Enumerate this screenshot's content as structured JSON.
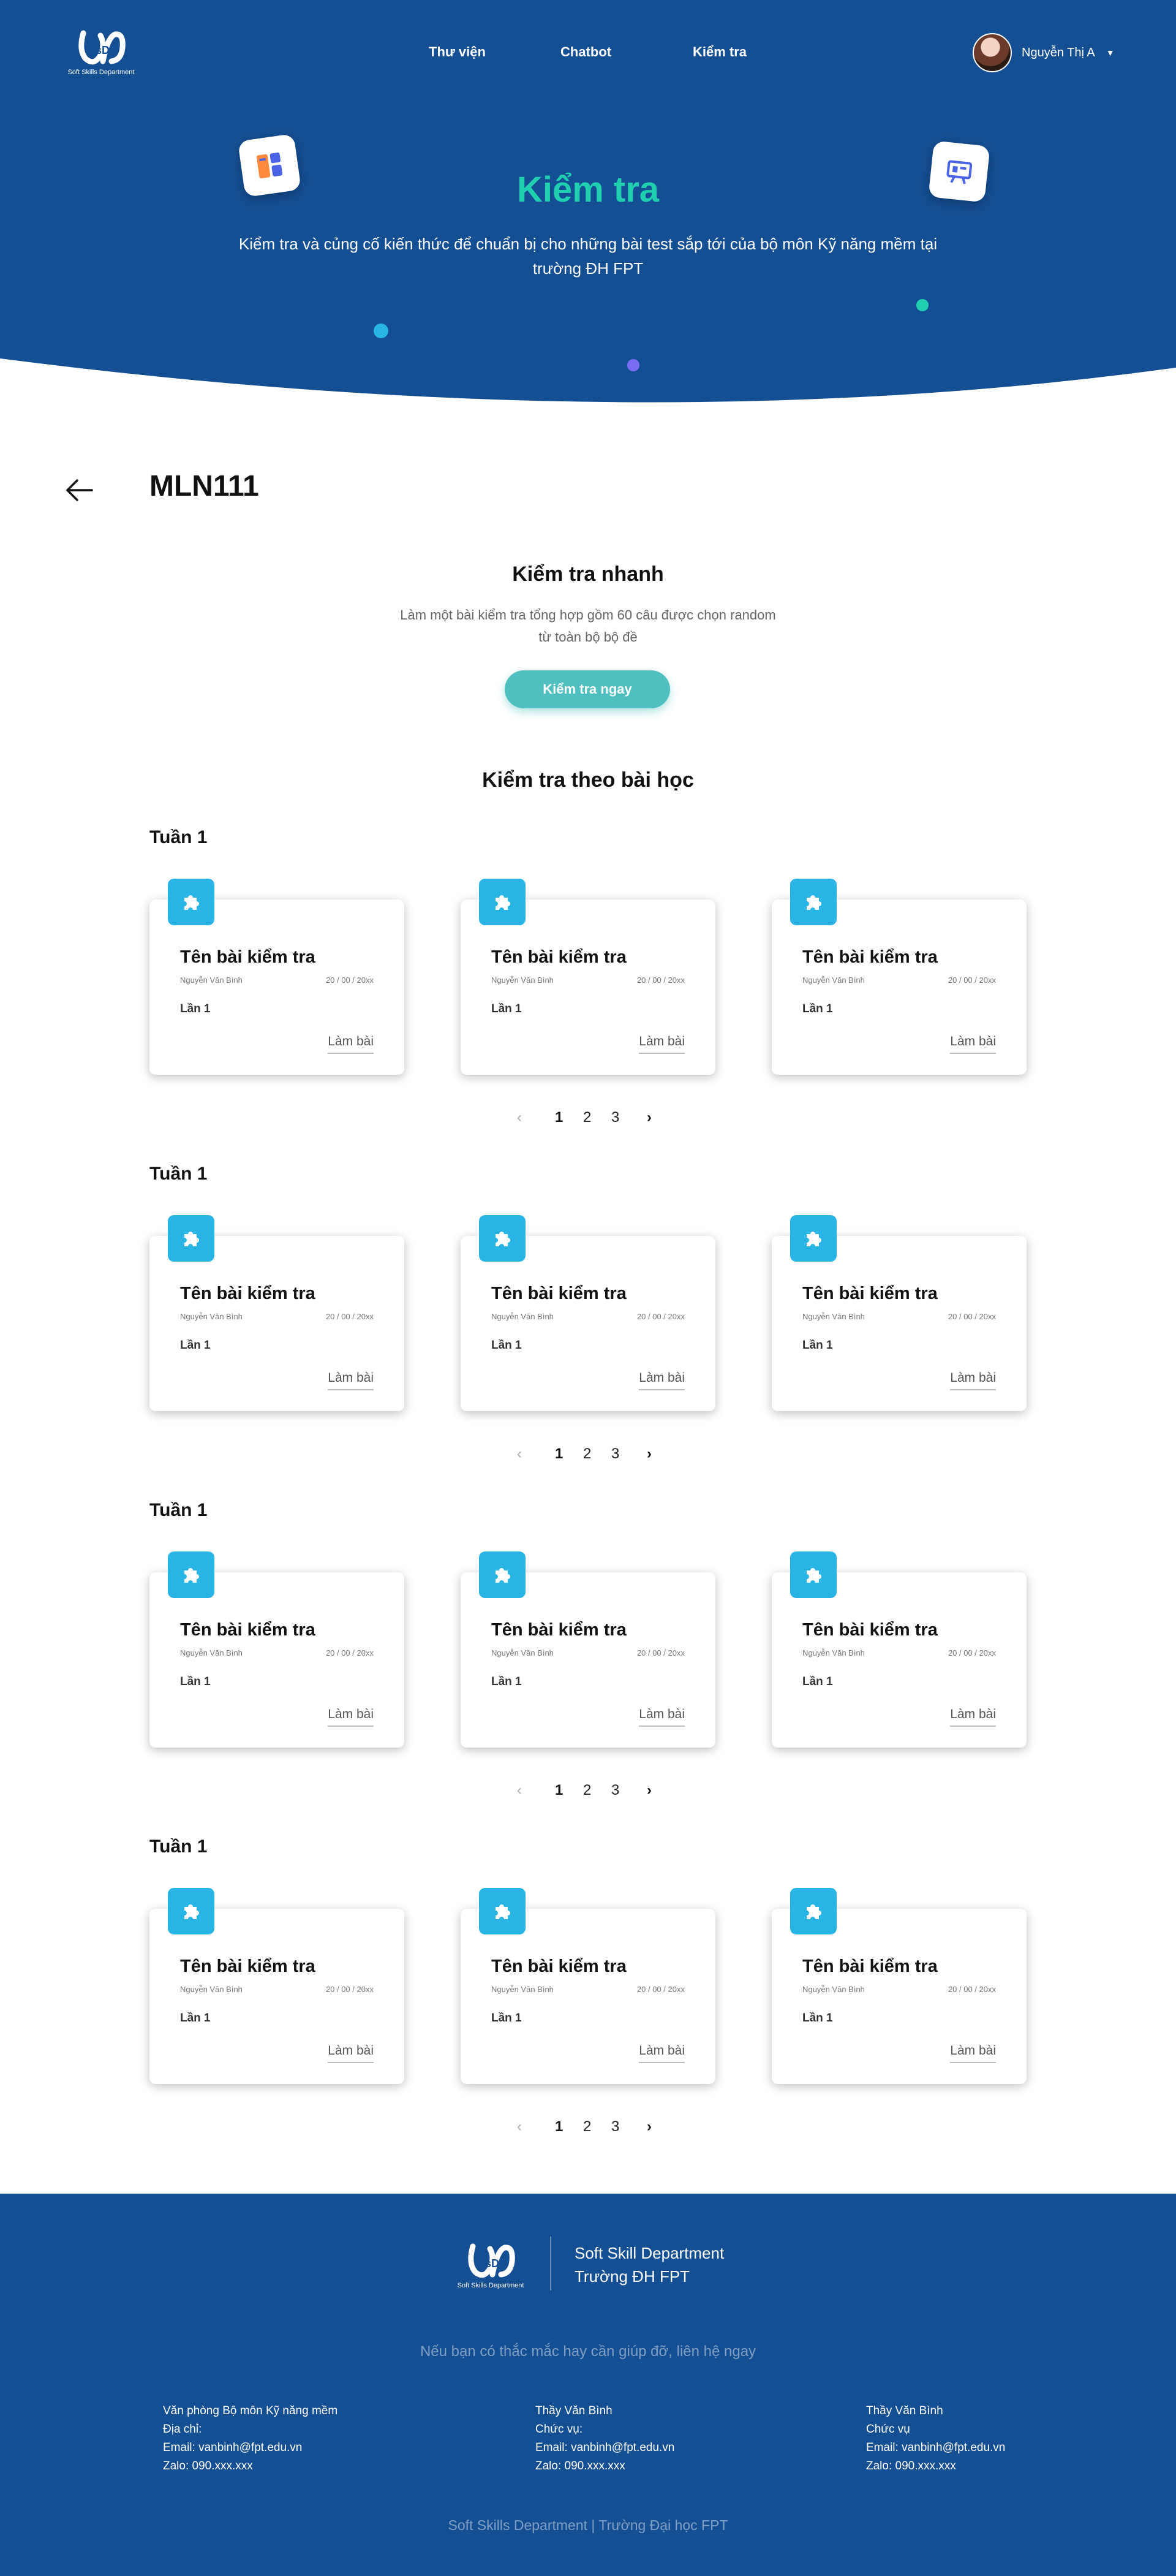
{
  "colors": {
    "primary_blue": "#154f93",
    "accent_teal": "#1fcfb0",
    "button_teal": "#4fbfbf",
    "badge_blue": "#29b4e6",
    "dot_blue": "#29b4e6",
    "dot_purple": "#7b6cf6",
    "dot_teal": "#1fcfb0"
  },
  "brand": {
    "logo_caption": "Soft Skills Department",
    "logo_icon": "sd-logo-icon"
  },
  "nav": {
    "links": [
      "Thư viện",
      "Chatbot",
      "Kiểm tra"
    ],
    "user_name": "Nguyễn Thị A",
    "user_menu_icon": "chevron-down-icon"
  },
  "hero": {
    "title": "Kiểm tra",
    "subtitle": "Kiểm tra và củng cố kiến thức để chuẩn bị cho những bài test sắp tới của bộ môn Kỹ năng mềm tại trường ĐH FPT",
    "icons": [
      "layout-icon",
      "presentation-board-icon"
    ]
  },
  "course": {
    "back_icon": "arrow-left-icon",
    "title": "MLN111"
  },
  "quick_test": {
    "title": "Kiểm tra nhanh",
    "description": "Làm một bài kiểm tra tổng hợp gồm 60 câu được chọn random từ toàn bộ bộ đề",
    "button_label": "Kiểm tra ngay"
  },
  "lessons": {
    "title": "Kiểm tra theo bài học",
    "card_icon": "puzzle-icon",
    "weeks": [
      {
        "label": "Tuần 1",
        "cards": [
          {
            "title": "Tên bài kiểm tra",
            "author": "Nguyễn Văn Bình",
            "date": "20 / 00 / 20xx",
            "attempt": "Lần 1",
            "action": "Làm bài"
          },
          {
            "title": "Tên bài kiểm tra",
            "author": "Nguyễn Văn Bình",
            "date": "20 / 00 / 20xx",
            "attempt": "Lần 1",
            "action": "Làm bài"
          },
          {
            "title": "Tên bài kiểm tra",
            "author": "Nguyễn Văn Bình",
            "date": "20 / 00 / 20xx",
            "attempt": "Lần 1",
            "action": "Làm bài"
          }
        ],
        "pagination": {
          "prev": "‹",
          "pages": [
            "1",
            "2",
            "3"
          ],
          "next": "›",
          "current": "1"
        }
      },
      {
        "label": "Tuần 1",
        "cards": [
          {
            "title": "Tên bài kiểm tra",
            "author": "Nguyễn Văn Bình",
            "date": "20 / 00 / 20xx",
            "attempt": "Lần 1",
            "action": "Làm bài"
          },
          {
            "title": "Tên bài kiểm tra",
            "author": "Nguyễn Văn Bình",
            "date": "20 / 00 / 20xx",
            "attempt": "Lần 1",
            "action": "Làm bài"
          },
          {
            "title": "Tên bài kiểm tra",
            "author": "Nguyễn Văn Bình",
            "date": "20 / 00 / 20xx",
            "attempt": "Lần 1",
            "action": "Làm bài"
          }
        ],
        "pagination": {
          "prev": "‹",
          "pages": [
            "1",
            "2",
            "3"
          ],
          "next": "›",
          "current": "1"
        }
      },
      {
        "label": "Tuần 1",
        "cards": [
          {
            "title": "Tên bài kiểm tra",
            "author": "Nguyễn Văn Bình",
            "date": "20 / 00 / 20xx",
            "attempt": "Lần 1",
            "action": "Làm bài"
          },
          {
            "title": "Tên bài kiểm tra",
            "author": "Nguyễn Văn Bình",
            "date": "20 / 00 / 20xx",
            "attempt": "Lần 1",
            "action": "Làm bài"
          },
          {
            "title": "Tên bài kiểm tra",
            "author": "Nguyễn Văn Bình",
            "date": "20 / 00 / 20xx",
            "attempt": "Lần 1",
            "action": "Làm bài"
          }
        ],
        "pagination": {
          "prev": "‹",
          "pages": [
            "1",
            "2",
            "3"
          ],
          "next": "›",
          "current": "1"
        }
      },
      {
        "label": "Tuần 1",
        "cards": [
          {
            "title": "Tên bài kiểm tra",
            "author": "Nguyễn Văn Bình",
            "date": "20 / 00 / 20xx",
            "attempt": "Lần 1",
            "action": "Làm bài"
          },
          {
            "title": "Tên bài kiểm tra",
            "author": "Nguyễn Văn Bình",
            "date": "20 / 00 / 20xx",
            "attempt": "Lần 1",
            "action": "Làm bài"
          },
          {
            "title": "Tên bài kiểm tra",
            "author": "Nguyễn Văn Bình",
            "date": "20 / 00 / 20xx",
            "attempt": "Lần 1",
            "action": "Làm bài"
          }
        ],
        "pagination": {
          "prev": "‹",
          "pages": [
            "1",
            "2",
            "3"
          ],
          "next": "›",
          "current": "1"
        }
      }
    ]
  },
  "footer": {
    "brand_line1": "Soft Skill Department",
    "brand_line2": "Trường ĐH FPT",
    "help_text": "Nếu bạn có thắc mắc hay cần giúp đỡ, liên hệ ngay",
    "contacts": [
      [
        "Văn phòng Bộ môn Kỹ năng mềm",
        "Địa chỉ:",
        "Email: vanbinh@fpt.edu.vn",
        "Zalo: 090.xxx.xxx"
      ],
      [
        "Thầy Văn Bình",
        "Chức vụ:",
        "Email: vanbinh@fpt.edu.vn",
        "Zalo: 090.xxx.xxx"
      ],
      [
        "Thầy Văn Bình",
        "Chức vụ",
        "Email: vanbinh@fpt.edu.vn",
        "Zalo: 090.xxx.xxx"
      ]
    ],
    "copyright": "Soft Skills Department | Trường Đại học FPT"
  }
}
